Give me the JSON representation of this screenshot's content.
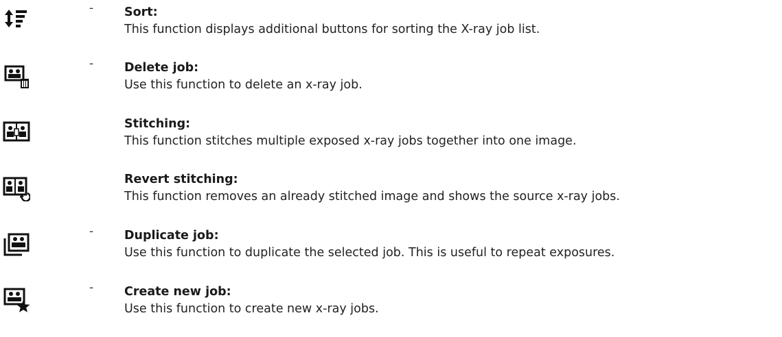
{
  "entries": [
    {
      "icon": "sort-icon",
      "dash": "-",
      "title": "Sort:",
      "description": "This function displays additional buttons for sorting the X-ray job list."
    },
    {
      "icon": "delete-job-icon",
      "dash": "-",
      "title": "Delete job:",
      "description": "Use this function to delete an x-ray job."
    },
    {
      "icon": "stitching-icon",
      "dash": "",
      "title": "Stitching:",
      "description": "This function stitches multiple exposed x-ray jobs together into one image."
    },
    {
      "icon": "revert-stitching-icon",
      "dash": "",
      "title": "Revert stitching:",
      "description": "This function removes an already stitched image and shows the source x-ray jobs."
    },
    {
      "icon": "duplicate-job-icon",
      "dash": "-",
      "title": "Duplicate job:",
      "description": "Use this function to duplicate the selected job. This is useful to repeat exposures."
    },
    {
      "icon": "create-new-job-icon",
      "dash": "-",
      "title": "Create new job:",
      "description": "Use this function to create new x-ray jobs."
    }
  ]
}
